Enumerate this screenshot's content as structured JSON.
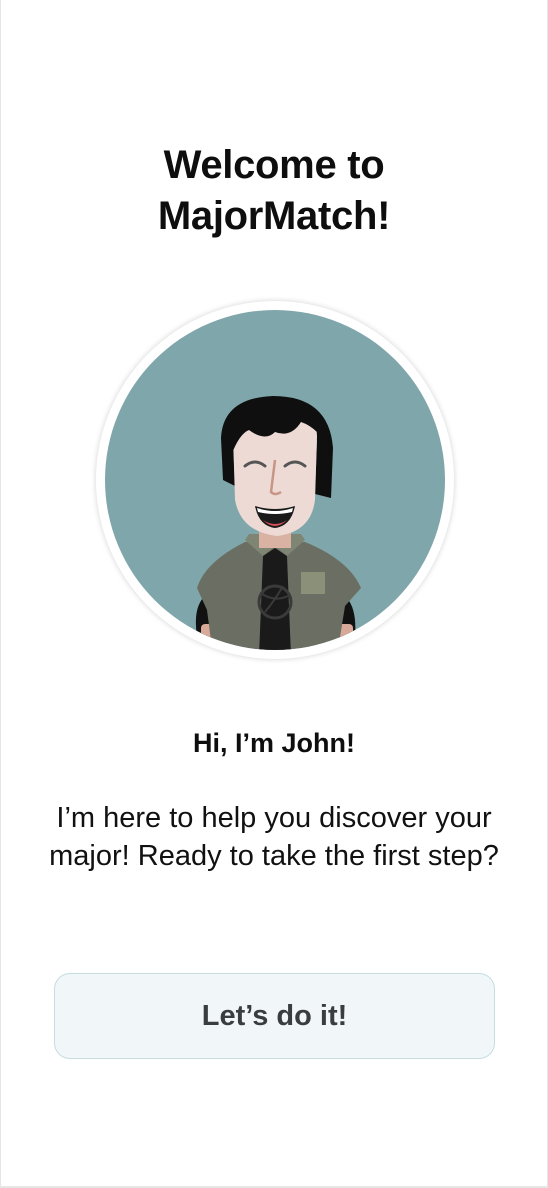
{
  "welcome": {
    "title_line1": "Welcome to",
    "title_line2": "MajorMatch!"
  },
  "mascot": {
    "name": "John",
    "icon": "mascot-avatar-icon",
    "background_color": "#7fa6aa"
  },
  "greeting": "Hi, I’m John!",
  "intro": "I’m here to help you discover your major! Ready to take the first step?",
  "cta": {
    "label": "Let’s do it!"
  },
  "colors": {
    "button_background": "#f1f6f8",
    "button_border": "#c6dde2",
    "button_text": "#3a3d40",
    "text": "#0e0e0e"
  }
}
